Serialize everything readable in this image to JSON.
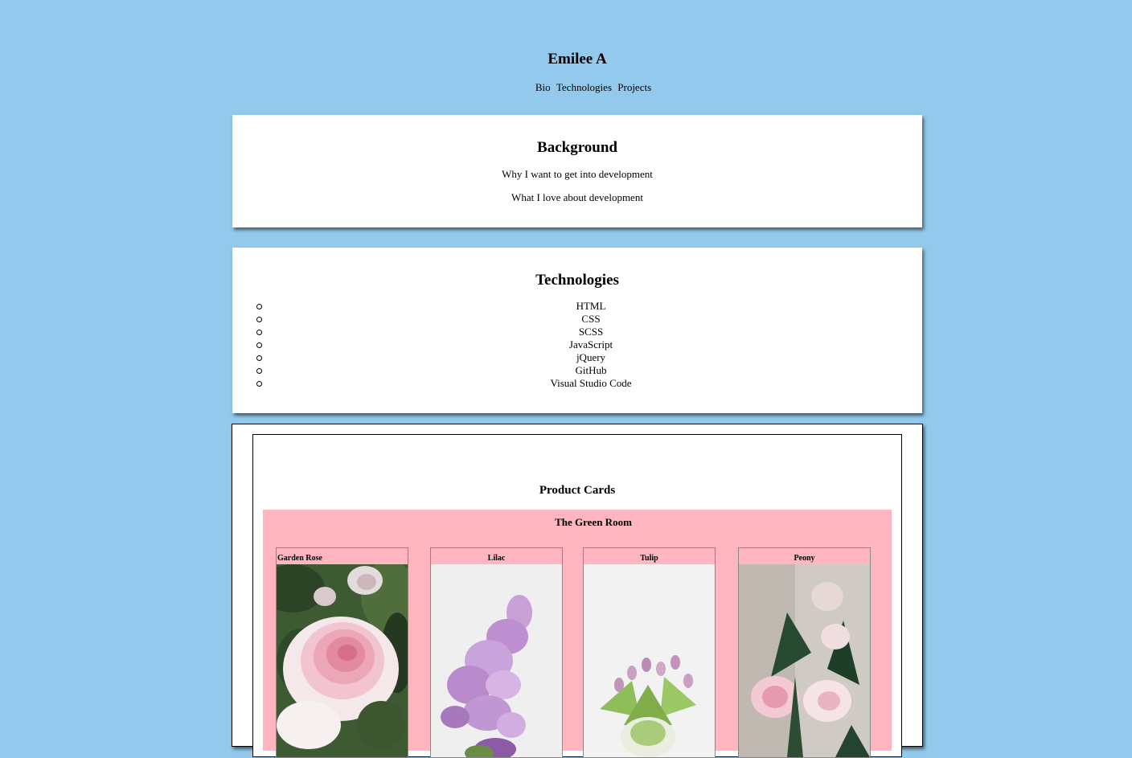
{
  "header": {
    "name": "Emilee A",
    "nav": [
      "Bio",
      "Technologies",
      "Projects"
    ]
  },
  "bio": {
    "heading": "Background",
    "lines": [
      "Why I want to get into development",
      "What I love about development"
    ]
  },
  "technologies": {
    "heading": "Technologies",
    "items": [
      "HTML",
      "CSS",
      "SCSS",
      "JavaScript",
      "jQuery",
      "GitHub",
      "Visual Studio Code"
    ]
  },
  "projects": {
    "heading": "Product Cards",
    "store": {
      "title": "The Green Room",
      "products": [
        {
          "name": "Garden Rose",
          "image": "garden-rose-photo"
        },
        {
          "name": "Lilac",
          "image": "lilac-photo"
        },
        {
          "name": "Tulip",
          "image": "tulip-photo"
        },
        {
          "name": "Peony",
          "image": "peony-photo"
        }
      ]
    }
  },
  "colors": {
    "page_background": "#93c9ec",
    "card_background": "#ffffff",
    "store_background": "#ffb6c1"
  }
}
